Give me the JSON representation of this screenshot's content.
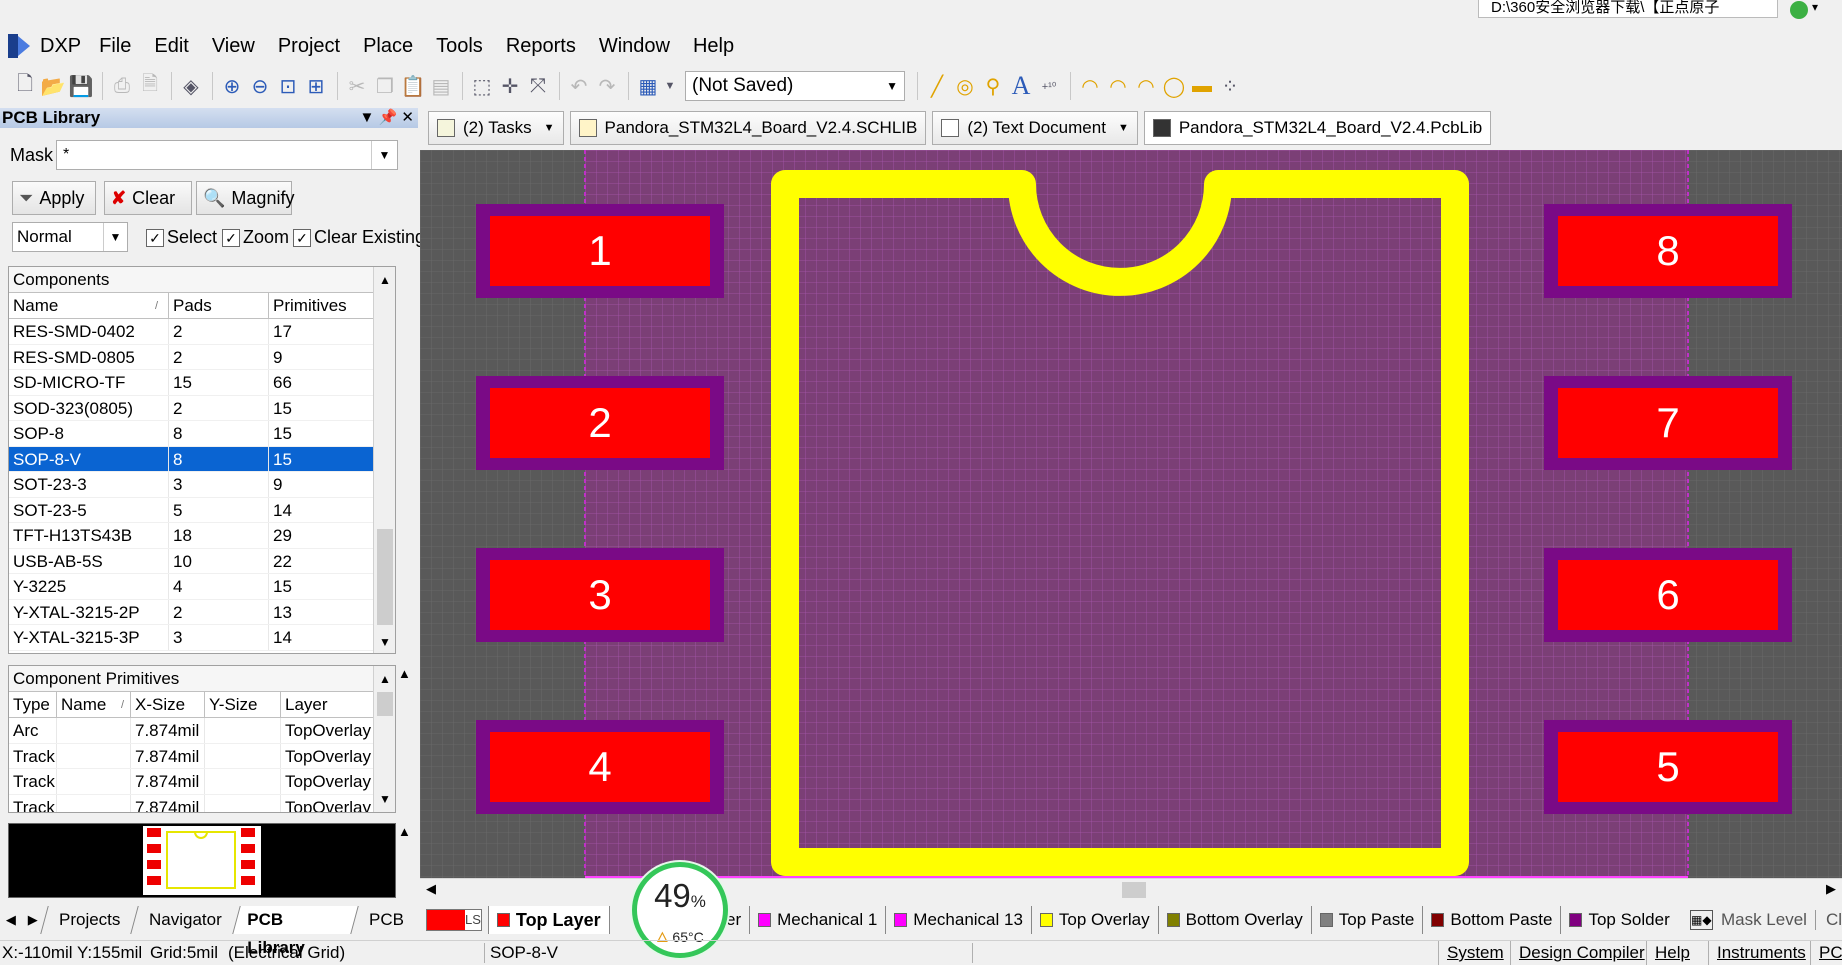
{
  "window": {
    "title_path": "D:\\360安全浏览器下载\\【正点原子",
    "app_logo": "dxp-logo"
  },
  "menu": [
    "DXP",
    "File",
    "Edit",
    "View",
    "Project",
    "Place",
    "Tools",
    "Reports",
    "Window",
    "Help"
  ],
  "toolbar": {
    "saved_state": "(Not Saved)",
    "icons": [
      "new-file-icon",
      "open-folder-icon",
      "save-icon",
      "print-icon",
      "print-preview-icon",
      "3d-view-icon",
      "zoom-in-icon",
      "zoom-out-icon",
      "zoom-fit-icon",
      "zoom-area-icon",
      "cut-icon",
      "copy-icon",
      "paste-icon",
      "rubber-stamp-icon",
      "select-area-icon",
      "move-icon",
      "deselect-icon",
      "undo-icon",
      "redo-icon",
      "grid-icon",
      "line-icon",
      "pad-icon",
      "via-icon",
      "string-icon",
      "coordinate-icon",
      "arc-center-icon",
      "arc-edge-icon",
      "arc-any-icon",
      "full-circle-icon",
      "fill-icon",
      "array-paste-icon"
    ]
  },
  "panel": {
    "title": "PCB Library",
    "mask_label": "Mask",
    "mask_value": "*",
    "apply_label": "Apply",
    "clear_label": "Clear",
    "magnify_label": "Magnify",
    "mode_value": "Normal",
    "select_label": "Select",
    "zoom_label": "Zoom",
    "clear_existing_label": "Clear Existing",
    "select_checked": true,
    "zoom_checked": true,
    "clear_existing_checked": true
  },
  "components": {
    "caption": "Components",
    "headers": [
      "Name",
      "Pads",
      "Primitives"
    ],
    "rows": [
      [
        "RES-SMD-0402",
        "2",
        "17"
      ],
      [
        "RES-SMD-0805",
        "2",
        "9"
      ],
      [
        "SD-MICRO-TF",
        "15",
        "66"
      ],
      [
        "SOD-323(0805)",
        "2",
        "15"
      ],
      [
        "SOP-8",
        "8",
        "15"
      ],
      [
        "SOP-8-V",
        "8",
        "15"
      ],
      [
        "SOT-23-3",
        "3",
        "9"
      ],
      [
        "SOT-23-5",
        "5",
        "14"
      ],
      [
        "TFT-H13TS43B",
        "18",
        "29"
      ],
      [
        "USB-AB-5S",
        "10",
        "22"
      ],
      [
        "Y-3225",
        "4",
        "15"
      ],
      [
        "Y-XTAL-3215-2P",
        "2",
        "13"
      ],
      [
        "Y-XTAL-3215-3P",
        "3",
        "14"
      ]
    ],
    "selected_index": 5
  },
  "primitives": {
    "caption": "Component Primitives",
    "headers": [
      "Type",
      "Name",
      "X-Size",
      "Y-Size",
      "Layer"
    ],
    "rows": [
      [
        "Arc",
        "",
        "7.874mil",
        "",
        "TopOverlay"
      ],
      [
        "Track",
        "",
        "7.874mil",
        "",
        "TopOverlay"
      ],
      [
        "Track",
        "",
        "7.874mil",
        "",
        "TopOverlay"
      ],
      [
        "Track",
        "",
        "7.874mil",
        "",
        "TopOverlay"
      ]
    ]
  },
  "panel_tabs": [
    "Projects",
    "Navigator",
    "PCB Library",
    "PCB"
  ],
  "panel_tab_active": "PCB Library",
  "doc_tabs": [
    "(2) Tasks",
    "Pandora_STM32L4_Board_V2.4.SCHLIB",
    "(2) Text Document",
    "Pandora_STM32L4_Board_V2.4.PcbLib"
  ],
  "footprint": {
    "pads_left": [
      "1",
      "2",
      "3",
      "4"
    ],
    "pads_right": [
      "8",
      "7",
      "6",
      "5"
    ]
  },
  "layers": {
    "ls_label": "LS",
    "tabs": [
      {
        "name": "Top Layer",
        "color": "#ff0000",
        "active": true
      },
      {
        "name": "Layer",
        "color": "#c0c0c0"
      },
      {
        "name": "Mechanical 1",
        "color": "#ff00ff"
      },
      {
        "name": "Mechanical 13",
        "color": "#ff00ff"
      },
      {
        "name": "Top Overlay",
        "color": "#ffff00"
      },
      {
        "name": "Bottom Overlay",
        "color": "#808000"
      },
      {
        "name": "Top Paste",
        "color": "#808080"
      },
      {
        "name": "Bottom Paste",
        "color": "#800000"
      },
      {
        "name": "Top Solder",
        "color": "#800080"
      }
    ],
    "mask_level": "Mask Level",
    "clear_short": "Cl"
  },
  "cpu_widget": {
    "percent": "49",
    "unit": "%",
    "temperature": "65°C"
  },
  "status": {
    "coords": "X:-110mil Y:155mil",
    "grid": "Grid:5mil",
    "grid_type": "(Electrical Grid)",
    "component": "SOP-8-V",
    "buttons": [
      "System",
      "Design Compiler",
      "Help",
      "Instruments",
      "PC"
    ]
  },
  "colors": {
    "board": "#7b3f76",
    "grid_line": "#9a5da0",
    "outside": "#595959",
    "pad": "#ff0000",
    "pad_mask": "#7a0a86",
    "overlay": "#ffff00",
    "selection": "#0a64d2"
  }
}
